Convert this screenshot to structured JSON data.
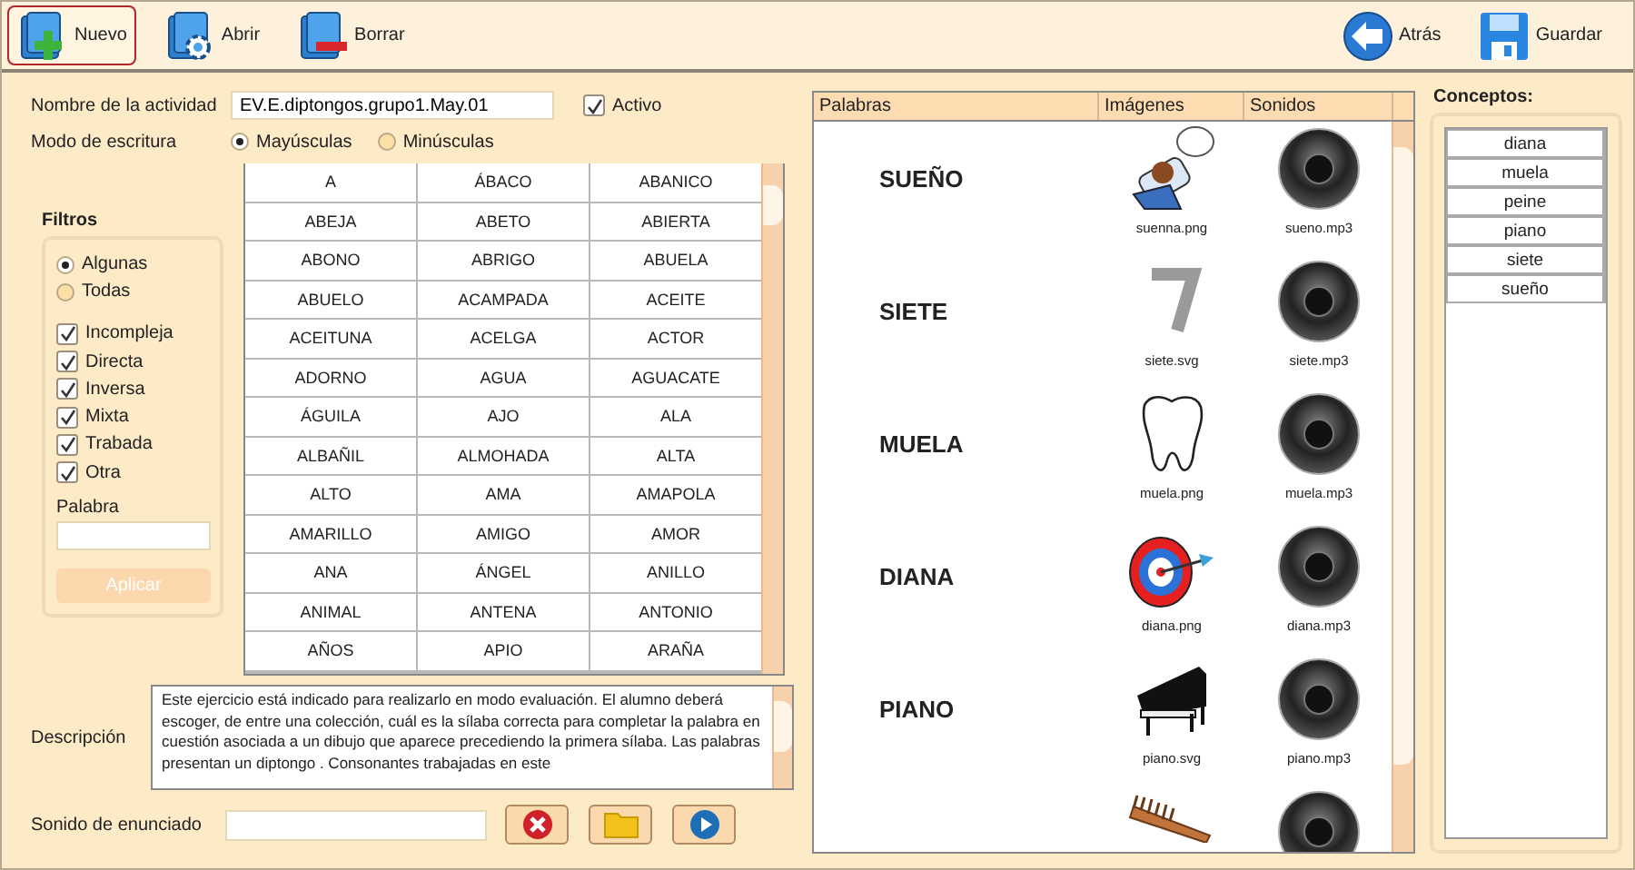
{
  "toolbar": {
    "left": [
      {
        "label": "Nuevo",
        "selected": true
      },
      {
        "label": "Abrir",
        "selected": false
      },
      {
        "label": "Borrar",
        "selected": false
      }
    ],
    "right": [
      "Atrás",
      "Guardar"
    ]
  },
  "activity": {
    "name_label": "Nombre de la actividad",
    "name_value": "EV.E.diptongos.grupo1.May.01",
    "active_label": "Activo",
    "active_checked": true,
    "mode_label": "Modo de escritura",
    "modes": [
      {
        "label": "Mayúsculas",
        "selected": true
      },
      {
        "label": "Minúsculas",
        "selected": false
      }
    ]
  },
  "filters": {
    "title": "Filtros",
    "scope": [
      {
        "label": "Algunas",
        "selected": true
      },
      {
        "label": "Todas",
        "selected": false
      }
    ],
    "types": [
      {
        "label": "Incompleja",
        "checked": true
      },
      {
        "label": "Directa",
        "checked": true
      },
      {
        "label": "Inversa",
        "checked": true
      },
      {
        "label": "Mixta",
        "checked": true
      },
      {
        "label": "Trabada",
        "checked": true
      },
      {
        "label": "Otra",
        "checked": true
      }
    ],
    "word_label": "Palabra",
    "apply": {
      "label": "Aplicar",
      "disabled": true
    }
  },
  "word_grid": [
    [
      "A",
      "ÁBACO",
      "ABANICO"
    ],
    [
      "ABEJA",
      "ABETO",
      "ABIERTA"
    ],
    [
      "ABONO",
      "ABRIGO",
      "ABUELA"
    ],
    [
      "ABUELO",
      "ACAMPADA",
      "ACEITE"
    ],
    [
      "ACEITUNA",
      "ACELGA",
      "ACTOR"
    ],
    [
      "ADORNO",
      "AGUA",
      "AGUACATE"
    ],
    [
      "ÁGUILA",
      "AJO",
      "ALA"
    ],
    [
      "ALBAÑIL",
      "ALMOHADA",
      "ALTA"
    ],
    [
      "ALTO",
      "AMA",
      "AMAPOLA"
    ],
    [
      "AMARILLO",
      "AMIGO",
      "AMOR"
    ],
    [
      "ANA",
      "ÁNGEL",
      "ANILLO"
    ],
    [
      "ANIMAL",
      "ANTENA",
      "ANTONIO"
    ],
    [
      "AÑOS",
      "APIO",
      "ARAÑA"
    ]
  ],
  "description": {
    "label": "Descripción",
    "text": "Este ejercicio está indicado para realizarlo en modo evaluación. El alumno deberá escoger, de entre una colección, cuál es la sílaba correcta para completar la palabra en cuestión asociada a un dibujo que aparece precediendo la primera sílaba. Las palabras presentan un diptongo . Consonantes trabajadas en este"
  },
  "sound": {
    "label": "Sonido de enunciado"
  },
  "table": {
    "columns": [
      "Palabras",
      "Imágenes",
      "Sonidos"
    ],
    "rows": [
      {
        "word": "SUEÑO",
        "kind": "sleep",
        "image": "suenna.png",
        "sound": "sueno.mp3"
      },
      {
        "word": "SIETE",
        "kind": "seven",
        "image": "siete.svg",
        "sound": "siete.mp3"
      },
      {
        "word": "MUELA",
        "kind": "tooth",
        "image": "muela.png",
        "sound": "muela.mp3"
      },
      {
        "word": "DIANA",
        "kind": "target",
        "image": "diana.png",
        "sound": "diana.mp3"
      },
      {
        "word": "PIANO",
        "kind": "piano",
        "image": "piano.svg",
        "sound": "piano.mp3"
      },
      {
        "kind": "comb"
      }
    ]
  },
  "concepts": {
    "title": "Conceptos:",
    "items": [
      "diana",
      "muela",
      "peine",
      "piano",
      "siete",
      "sueño"
    ]
  }
}
